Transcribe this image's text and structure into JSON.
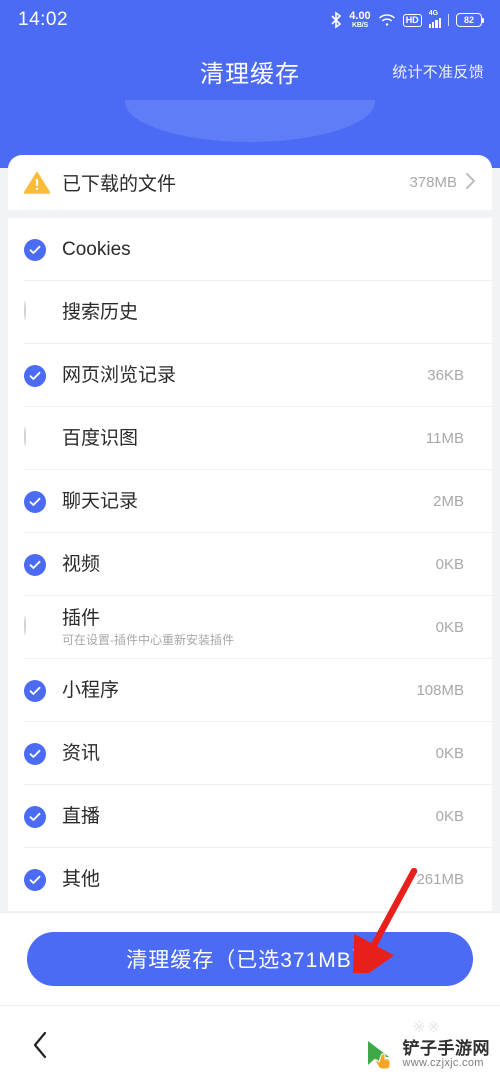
{
  "status_bar": {
    "time": "14:02",
    "bluetooth_icon": "bluetooth-icon",
    "net_speed_value": "4.00",
    "net_speed_unit": "KB/S",
    "wifi_icon": "wifi-icon",
    "hd_label": "HD",
    "network_label": "4G",
    "battery_level": "82"
  },
  "header": {
    "title": "清理缓存",
    "feedback_label": "统计不准反馈"
  },
  "downloaded": {
    "icon": "warning-icon",
    "label": "已下载的文件",
    "size": "378MB",
    "chevron": "chevron-right-icon"
  },
  "list": [
    {
      "label": "Cookies",
      "sub": "",
      "size": "",
      "checked": true
    },
    {
      "label": "搜索历史",
      "sub": "",
      "size": "",
      "checked": false
    },
    {
      "label": "网页浏览记录",
      "sub": "",
      "size": "36KB",
      "checked": true
    },
    {
      "label": "百度识图",
      "sub": "",
      "size": "11MB",
      "checked": false
    },
    {
      "label": "聊天记录",
      "sub": "",
      "size": "2MB",
      "checked": true
    },
    {
      "label": "视频",
      "sub": "",
      "size": "0KB",
      "checked": true
    },
    {
      "label": "插件",
      "sub": "可在设置-插件中心重新安装插件",
      "size": "0KB",
      "checked": false
    },
    {
      "label": "小程序",
      "sub": "",
      "size": "108MB",
      "checked": true
    },
    {
      "label": "资讯",
      "sub": "",
      "size": "0KB",
      "checked": true
    },
    {
      "label": "直播",
      "sub": "",
      "size": "0KB",
      "checked": true
    },
    {
      "label": "其他",
      "sub": "",
      "size": "261MB",
      "checked": true
    }
  ],
  "cta": {
    "label": "清理缓存（已选371MB）"
  },
  "navigation": {
    "back_icon": "back-chevron-icon"
  },
  "watermark": {
    "site_name": "铲子手游网",
    "site_url": "www.czjxjc.com",
    "cursor_icon": "cursor-arrow-icon"
  },
  "annotation": {
    "arrow_icon": "red-arrow-icon",
    "arrow_color": "#e8201c"
  },
  "colors": {
    "brand_blue": "#4b6bf5",
    "arc_blue": "#6280f7",
    "page_bg": "#f2f3f5",
    "warning_amber": "#fbbc3c",
    "muted_text": "#a8a8ad",
    "primary_text": "#2b2b2b"
  }
}
